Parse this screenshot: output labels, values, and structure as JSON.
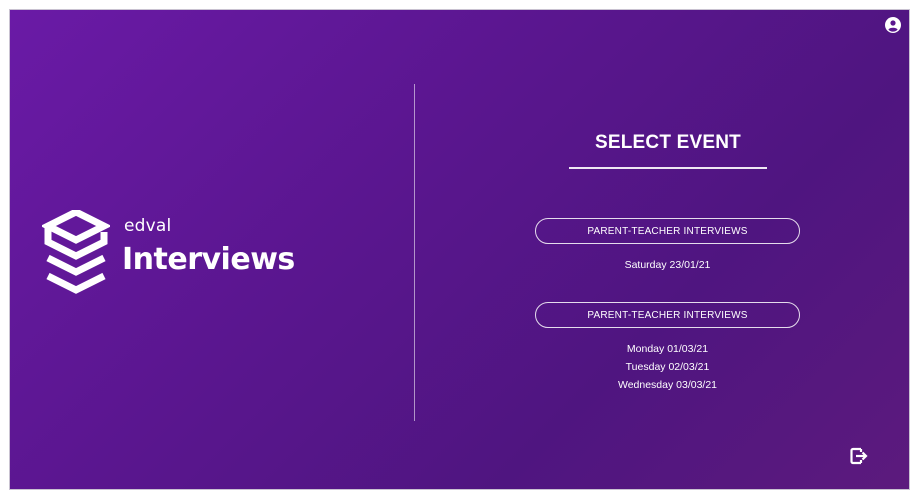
{
  "header": {
    "user_icon": "user-circle-icon"
  },
  "logo": {
    "small_text": "edval",
    "big_text": "Interviews",
    "mark_icon": "edval-layers-logo"
  },
  "panel": {
    "title": "SELECT EVENT",
    "events": [
      {
        "label": "PARENT-TEACHER INTERVIEWS",
        "dates": [
          "Saturday 23/01/21"
        ]
      },
      {
        "label": "PARENT-TEACHER INTERVIEWS",
        "dates": [
          "Monday 01/03/21",
          "Tuesday 02/03/21",
          "Wednesday 03/03/21"
        ]
      }
    ]
  },
  "footer": {
    "exit_icon": "logout-icon"
  },
  "colors": {
    "background": "#5a168f",
    "accent": "#ffffff"
  }
}
